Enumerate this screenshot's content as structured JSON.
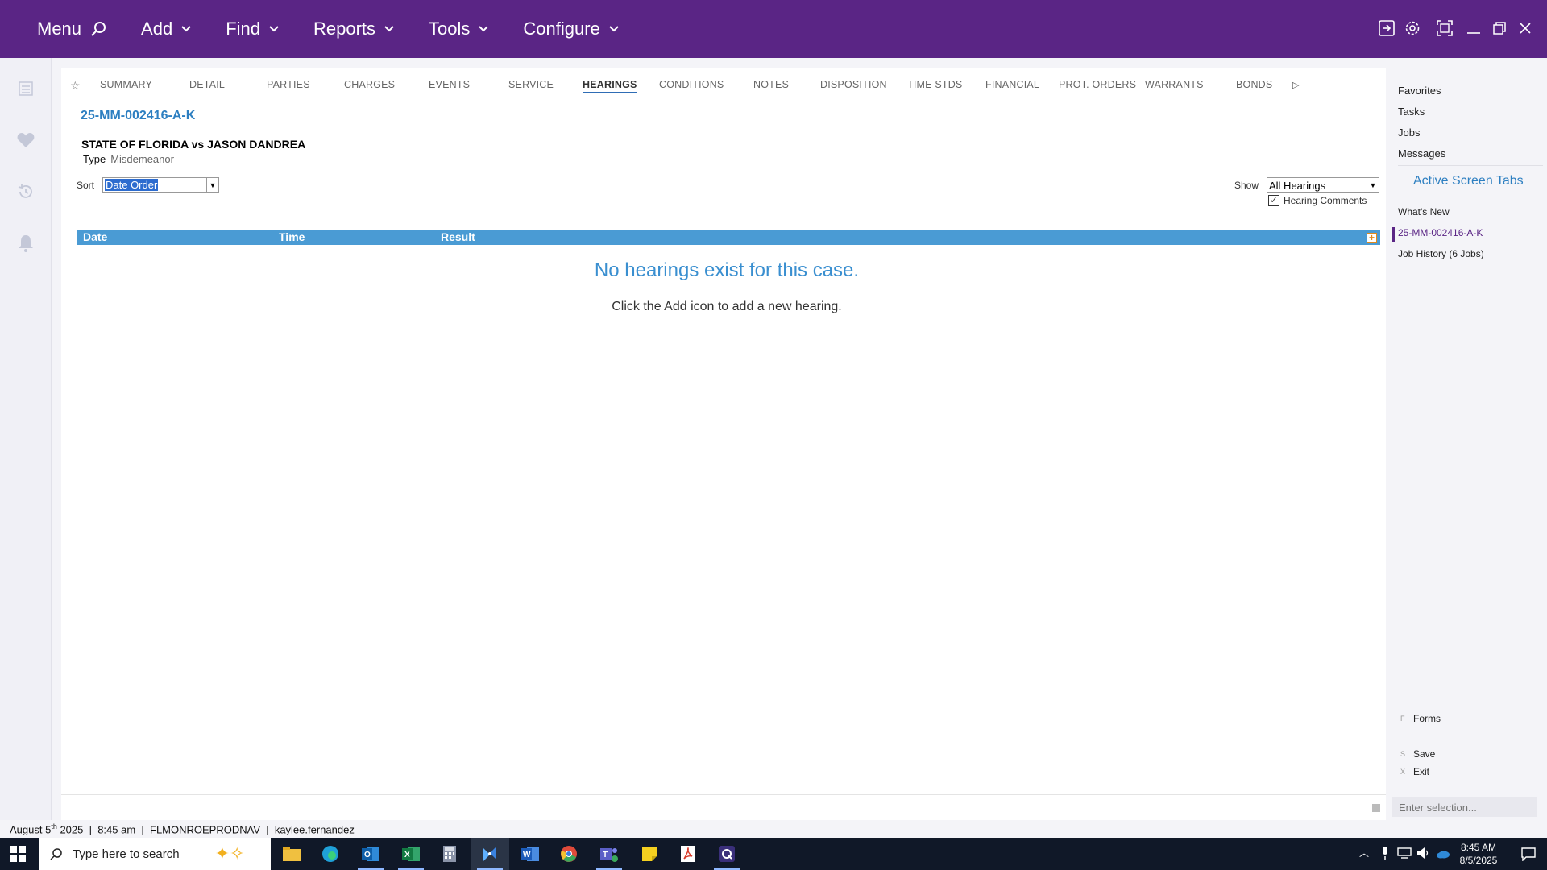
{
  "topnav": {
    "menu": "Menu",
    "add": "Add",
    "find": "Find",
    "reports": "Reports",
    "tools": "Tools",
    "configure": "Configure"
  },
  "tabs": [
    "SUMMARY",
    "DETAIL",
    "PARTIES",
    "CHARGES",
    "EVENTS",
    "SERVICE",
    "HEARINGS",
    "CONDITIONS",
    "NOTES",
    "DISPOSITION",
    "TIME STDS",
    "FINANCIAL",
    "PROT. ORDERS",
    "WARRANTS",
    "BONDS"
  ],
  "active_tab": "HEARINGS",
  "case": {
    "number": "25-MM-002416-A-K",
    "title": "STATE OF FLORIDA vs JASON DANDREA",
    "type_label": "Type",
    "type_value": "Misdemeanor"
  },
  "sort": {
    "label": "Sort",
    "value": "Date Order"
  },
  "show": {
    "label": "Show",
    "value": "All Hearings",
    "hearing_comments_label": "Hearing Comments",
    "hearing_comments_checked": true
  },
  "grid": {
    "columns": [
      "Date",
      "Time",
      "Result"
    ],
    "empty_message": "No hearings exist for this case.",
    "empty_hint": "Click the Add icon to add a new hearing."
  },
  "right_panel": {
    "links": [
      "Favorites",
      "Tasks",
      "Jobs",
      "Messages"
    ],
    "heading": "Active Screen Tabs",
    "screen_tabs": [
      "What's New",
      "25-MM-002416-A-K",
      "Job History (6 Jobs)"
    ],
    "actions": [
      {
        "key": "F",
        "label": "Forms"
      },
      {
        "key": "S",
        "label": "Save"
      },
      {
        "key": "X",
        "label": "Exit"
      }
    ],
    "selection_placeholder": "Enter selection..."
  },
  "status": {
    "text_pre": "August 5",
    "text_sup": "th",
    "text_post": " 2025  |  8:45 am  |  FLMONROEPRODNAV  |  kaylee.fernandez"
  },
  "taskbar": {
    "search_placeholder": "Type here to search",
    "time": "8:45 AM",
    "date": "8/5/2025"
  },
  "colors": {
    "topbar": "#5a2585",
    "accent": "#2d7fc1",
    "grid_header": "#4a9bd4"
  }
}
